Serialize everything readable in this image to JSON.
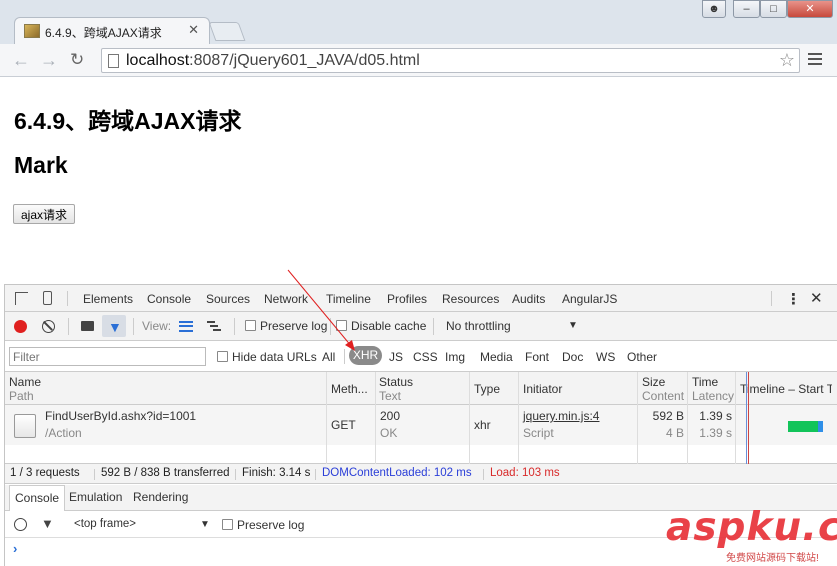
{
  "browser": {
    "tab_title": "6.4.9、跨域AJAX请求",
    "url_host": "localhost",
    "url_rest": ":8087/jQuery601_JAVA/d05.html"
  },
  "page": {
    "heading": "6.4.9、跨域AJAX请求",
    "subheading": "Mark",
    "ajax_button": "ajax请求"
  },
  "devtools": {
    "tabs": [
      "Elements",
      "Console",
      "Sources",
      "Network",
      "Timeline",
      "Profiles",
      "Resources",
      "Audits",
      "AngularJS"
    ],
    "active_tab": "Network",
    "network_toolbar": {
      "view_label": "View:",
      "preserve_log": "Preserve log",
      "disable_cache": "Disable cache",
      "throttling": "No throttling"
    },
    "filter": {
      "placeholder": "Filter",
      "hide_data_urls": "Hide data URLs",
      "types": [
        "All",
        "XHR",
        "JS",
        "CSS",
        "Img",
        "Media",
        "Font",
        "Doc",
        "WS",
        "Other"
      ],
      "active_type": "XHR"
    },
    "columns": {
      "name": "Name",
      "name_sub": "Path",
      "method": "Meth...",
      "status": "Status",
      "status_sub": "Text",
      "type": "Type",
      "initiator": "Initiator",
      "size": "Size",
      "size_sub": "Content",
      "time": "Time",
      "time_sub": "Latency",
      "timeline": "Timeline – Start T"
    },
    "rows": [
      {
        "name": "FindUserById.ashx?id=1001",
        "path": "/Action",
        "method": "GET",
        "status": "200",
        "status_text": "OK",
        "type": "xhr",
        "initiator": "jquery.min.js:4",
        "initiator_type": "Script",
        "size": "592 B",
        "content": "4 B",
        "time": "1.39 s",
        "latency": "1.39 s"
      }
    ],
    "summary": {
      "requests": "1 / 3 requests",
      "transferred": "592 B / 838 B transferred",
      "finish": "Finish: 3.14 s",
      "dom_content_loaded": "DOMContentLoaded: 102 ms",
      "load": "Load: 103 ms"
    },
    "drawer": {
      "tabs": [
        "Console",
        "Emulation",
        "Rendering"
      ],
      "active_tab": "Console",
      "context": "<top frame>",
      "preserve_log": "Preserve log",
      "prompt": "›"
    }
  },
  "watermark": {
    "brand": "aspku.com",
    "tagline": "免费网站源码下载站!"
  },
  "colors": {
    "record": "#e0201f",
    "accent_blue": "#2a6fd6",
    "dom_content_loaded": "#2a3ed8",
    "load": "#d82a2a",
    "timeline_waiting": "#12c45a",
    "annotation_arrow": "#e02020"
  }
}
